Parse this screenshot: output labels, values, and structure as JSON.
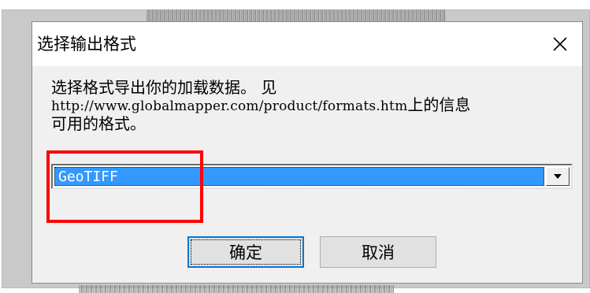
{
  "dialog": {
    "title": "选择输出格式",
    "message_line1": "选择格式导出你的加载数据。 见",
    "message_line2_url": "http://www.globalmapper.com/product/formats.htm",
    "message_line2_suffix": "上的信息",
    "message_line3": "可用的格式。"
  },
  "format_select": {
    "selected_value": "GeoTIFF"
  },
  "buttons": {
    "ok_label": "确定",
    "cancel_label": "取消"
  },
  "icons": {
    "close": "close-icon",
    "dropdown": "chevron-down-icon"
  },
  "colors": {
    "selection": "#3399ff",
    "annotation": "#ff0000",
    "focus_border": "#0078d7"
  }
}
